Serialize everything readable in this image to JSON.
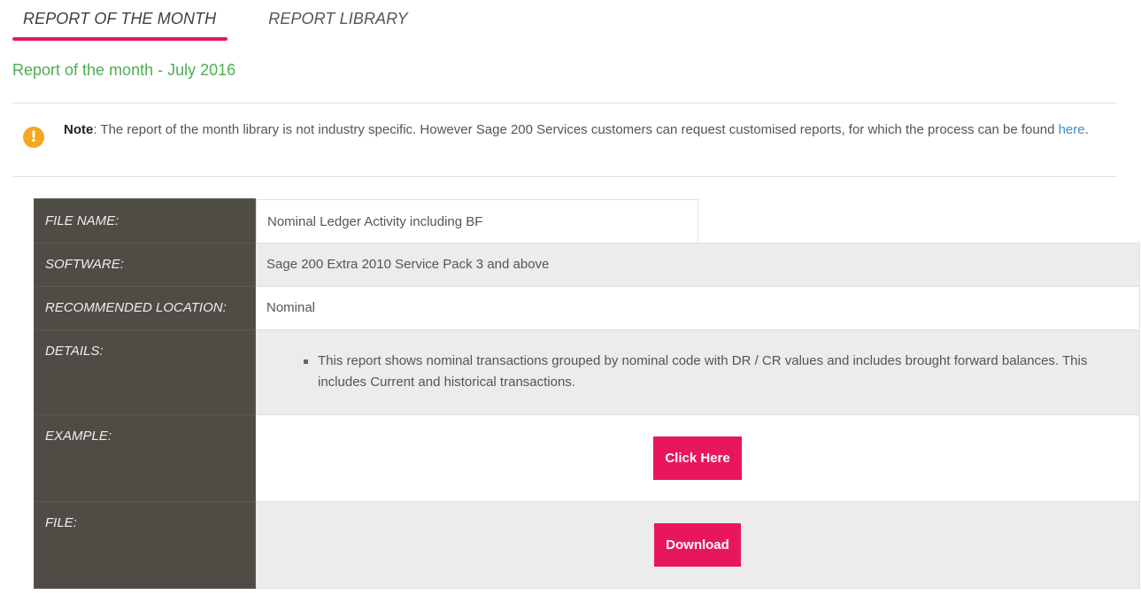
{
  "tabs": [
    {
      "label": "REPORT OF THE MONTH",
      "active": true
    },
    {
      "label": "REPORT LIBRARY",
      "active": false
    }
  ],
  "page_title": "Report of the month - July 2016",
  "note": {
    "icon": "exclamation-icon",
    "bold": "Note",
    "text": ": The report of the month library is not industry specific. However Sage 200 Services customers can request customised reports, for which the process can be found ",
    "link": "here",
    "end": "."
  },
  "table": {
    "file_name": {
      "label": "FILE NAME:",
      "value": "Nominal Ledger Activity including BF"
    },
    "software": {
      "label": "SOFTWARE:",
      "value": "Sage 200 Extra 2010 Service Pack 3 and above"
    },
    "location": {
      "label": "RECOMMENDED LOCATION:",
      "value": "Nominal"
    },
    "details": {
      "label": "DETAILS:",
      "items": [
        "This report shows nominal transactions grouped by nominal code with DR / CR values and includes brought forward balances. This includes Current and historical transactions."
      ]
    },
    "example": {
      "label": "EXAMPLE:",
      "button": "Click Here"
    },
    "file": {
      "label": "FILE:",
      "button": "Download"
    }
  },
  "colors": {
    "accent": "#e8175d",
    "title_green": "#4caf50",
    "label_bg": "#4f4c45",
    "warning": "#f5a623",
    "link": "#3a8fc7"
  }
}
